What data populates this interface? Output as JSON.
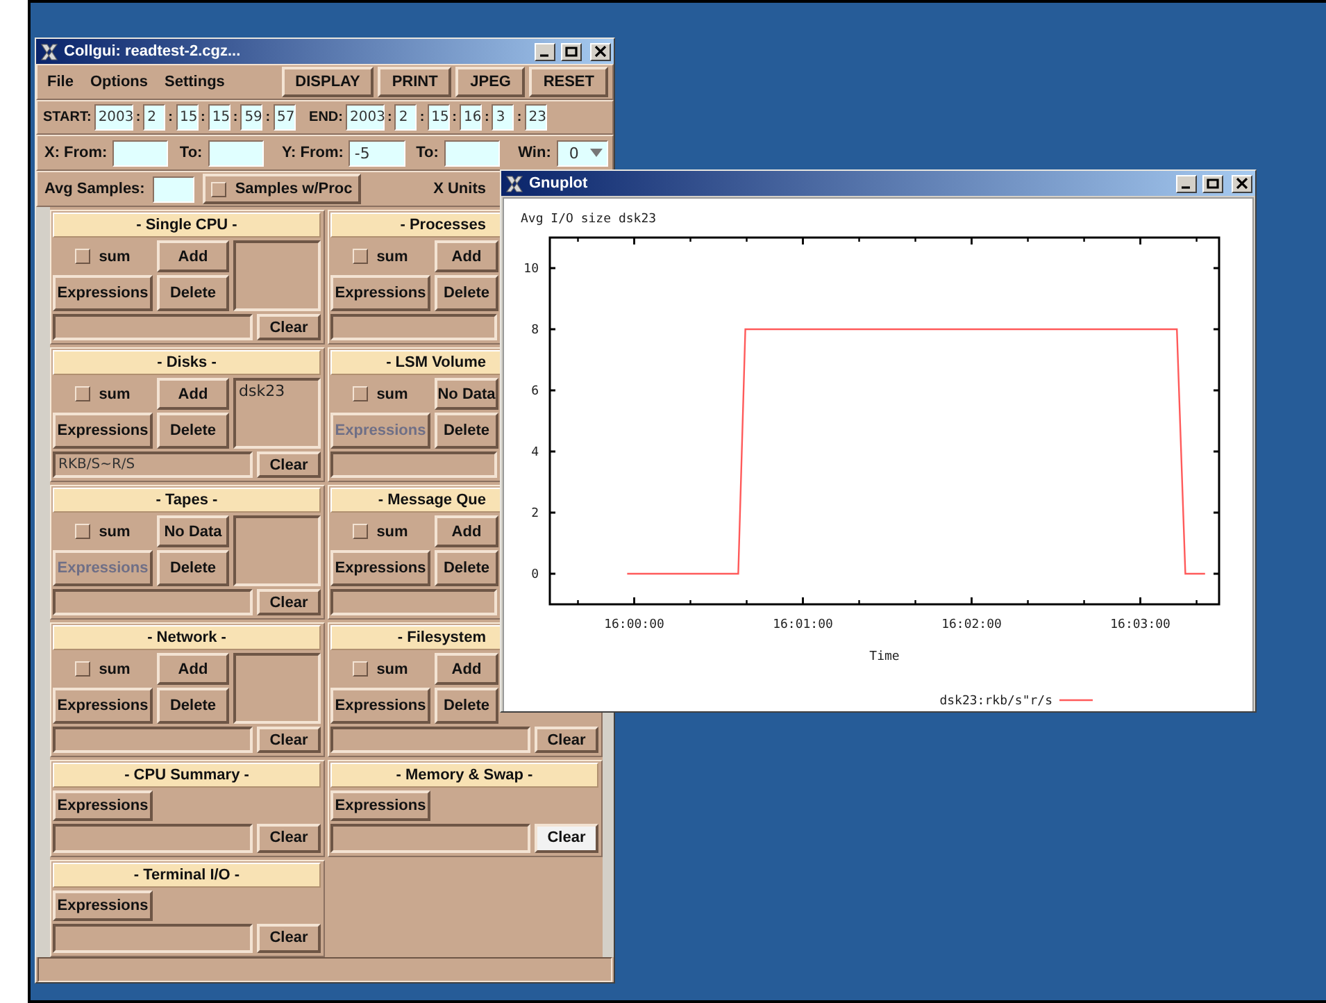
{
  "collgui": {
    "window": {
      "title": "Collgui: readtest-2.cgz..."
    },
    "menu": [
      "File",
      "Options",
      "Settings"
    ],
    "toolbar": [
      "DISPLAY",
      "PRINT",
      "JPEG",
      "RESET"
    ],
    "date_range": {
      "separator": ":",
      "start": {
        "label": "START:",
        "fields": [
          "2003",
          "2",
          "15",
          "15",
          "59",
          "57"
        ]
      },
      "end": {
        "label": "END:",
        "fields": [
          "2003",
          "2",
          "15",
          "16",
          "3",
          "23"
        ]
      }
    },
    "axis_range": [
      {
        "label": "X: From:",
        "kind": "field"
      },
      {
        "label": "To:",
        "kind": "field"
      },
      {
        "label": "Y: From:",
        "kind": "field",
        "value": "-5"
      },
      {
        "label": "To:",
        "kind": "field"
      },
      {
        "label": "Win:",
        "kind": "dropdown",
        "value": "0"
      }
    ],
    "options": {
      "label": "Avg Samples:",
      "checkbox": {
        "label": "Samples w/Proc",
        "checked": false
      },
      "units_label": "X Units"
    },
    "panels": [
      {
        "kind": "full",
        "title": "- Single CPU -",
        "clipped": false,
        "sum": {
          "label": "sum",
          "checked": false
        },
        "add": "Add",
        "expressions": {
          "label": "Expressions",
          "disabled": false
        },
        "delete": "Delete",
        "clear": {
          "label": "Clear",
          "highlighted": false
        }
      },
      {
        "kind": "full",
        "title": "- Processes",
        "clipped": true,
        "sum": {
          "label": "sum",
          "checked": false
        },
        "add": "Add",
        "expressions": {
          "label": "Expressions",
          "disabled": false
        },
        "delete": "Delete"
      },
      {
        "kind": "full",
        "title": "- Disks -",
        "clipped": false,
        "sum": {
          "label": "sum",
          "checked": false
        },
        "add": "Add",
        "expressions": {
          "label": "Expressions",
          "disabled": false
        },
        "delete": "Delete",
        "list": [
          "dsk23"
        ],
        "field": "RKB/S~R/S",
        "clear": {
          "label": "Clear",
          "highlighted": false
        }
      },
      {
        "kind": "full",
        "title": "- LSM Volume",
        "clipped": true,
        "sum": {
          "label": "sum",
          "checked": false
        },
        "add": "No Data",
        "expressions": {
          "label": "Expressions",
          "disabled": true
        },
        "delete": "Delete"
      },
      {
        "kind": "full",
        "title": "- Tapes -",
        "clipped": false,
        "sum": {
          "label": "sum",
          "checked": false
        },
        "add": "No Data",
        "expressions": {
          "label": "Expressions",
          "disabled": true
        },
        "delete": "Delete",
        "clear": {
          "label": "Clear",
          "highlighted": false
        }
      },
      {
        "kind": "full",
        "title": "- Message Que",
        "clipped": true,
        "sum": {
          "label": "sum",
          "checked": false
        },
        "add": "Add",
        "expressions": {
          "label": "Expressions",
          "disabled": false
        },
        "delete": "Delete"
      },
      {
        "kind": "full",
        "title": "- Network -",
        "clipped": false,
        "sum": {
          "label": "sum",
          "checked": false
        },
        "add": "Add",
        "expressions": {
          "label": "Expressions",
          "disabled": false
        },
        "delete": "Delete",
        "clear": {
          "label": "Clear",
          "highlighted": false
        }
      },
      {
        "kind": "full",
        "title": "- Filesystem",
        "clipped": true,
        "sum": {
          "label": "sum",
          "checked": false
        },
        "add": "Add",
        "expressions": {
          "label": "Expressions",
          "disabled": false
        },
        "delete": "Delete",
        "clear": {
          "label": "Clear",
          "highlighted": false
        }
      },
      {
        "kind": "simple",
        "title": "- CPU Summary -",
        "clipped": false,
        "expressions": {
          "label": "Expressions",
          "disabled": false
        },
        "clear": {
          "label": "Clear",
          "highlighted": false
        }
      },
      {
        "kind": "simple",
        "title": "- Memory & Swap -",
        "clipped": false,
        "expressions": {
          "label": "Expressions",
          "disabled": false
        },
        "clear": {
          "label": "Clear",
          "highlighted": true
        }
      },
      {
        "kind": "simple",
        "title": "- Terminal I/O -",
        "clipped": false,
        "expressions": {
          "label": "Expressions",
          "disabled": false
        },
        "clear": {
          "label": "Clear",
          "highlighted": false
        }
      }
    ]
  },
  "gnuplot": {
    "window": {
      "title": "Gnuplot"
    },
    "chart_data": {
      "type": "line",
      "title": "Avg I/O size dsk23",
      "xlabel": "Time",
      "x": [
        57597.5,
        57637,
        57639.5,
        57793,
        57796,
        57803
      ],
      "series": [
        {
          "name": "dsk23:rkb/s\"r/s",
          "color": "#ff5a5a",
          "values": [
            0,
            0,
            8,
            8,
            0,
            0
          ]
        }
      ],
      "xlim": [
        57570,
        57808
      ],
      "ylim": [
        -1,
        11
      ],
      "xticks": [
        {
          "value": 57600,
          "label": "16:00:00"
        },
        {
          "value": 57660,
          "label": "16:01:00"
        },
        {
          "value": 57720,
          "label": "16:02:00"
        },
        {
          "value": 57780,
          "label": "16:03:00"
        }
      ],
      "yticks": [
        0,
        2,
        4,
        6,
        8,
        10
      ]
    }
  }
}
